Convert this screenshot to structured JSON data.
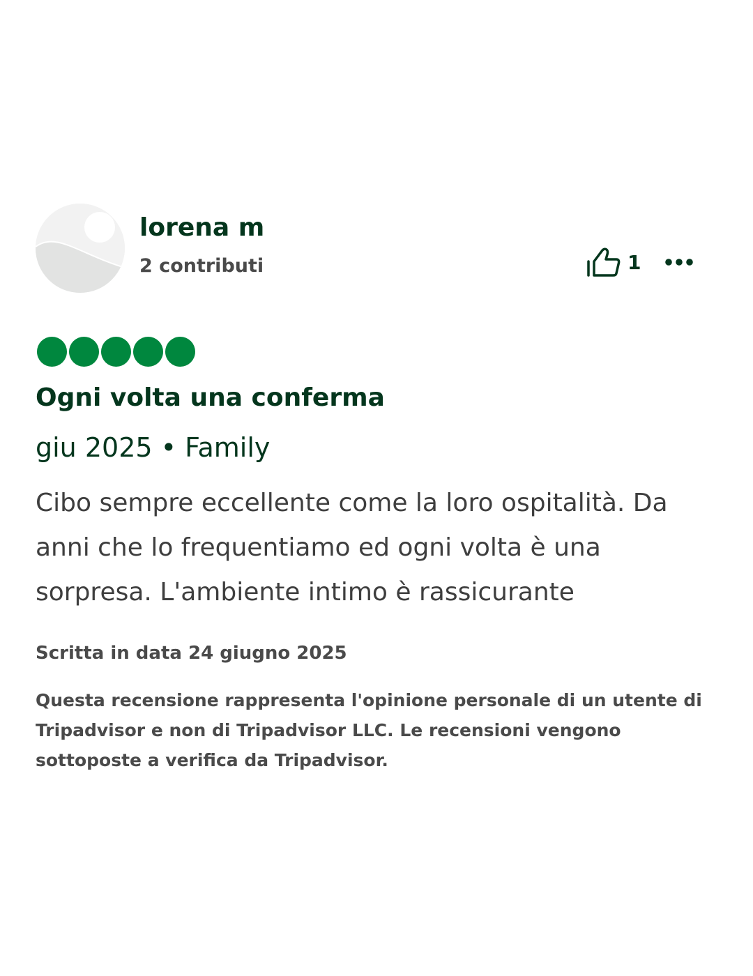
{
  "reviewer": {
    "name": "lorena m",
    "contributions": "2 contributi"
  },
  "actions": {
    "helpful_count": "1",
    "more_icon": "more-horizontal-icon",
    "helpful_icon": "thumbs-up-icon"
  },
  "review": {
    "rating": 5,
    "rating_max": 5,
    "title": "Ogni volta una conferma",
    "meta": "giu 2025 • Family",
    "body": "Cibo sempre eccellente come la loro ospitalità. Da anni che lo frequentiamo ed ogni volta è una sorpresa. L'ambiente intimo è rassicurante",
    "written_date": "Scritta in data 24 giugno 2025",
    "disclaimer": "Questa recensione rappresenta l'opinione personale di un utente di Tripadvisor e non di Tripadvisor LLC. Le recensioni vengono sottoposte a verifica da Tripadvisor."
  },
  "colors": {
    "brand_green": "#00873e",
    "text_dark_green": "#04361d",
    "text_gray": "#4a4a4a"
  }
}
